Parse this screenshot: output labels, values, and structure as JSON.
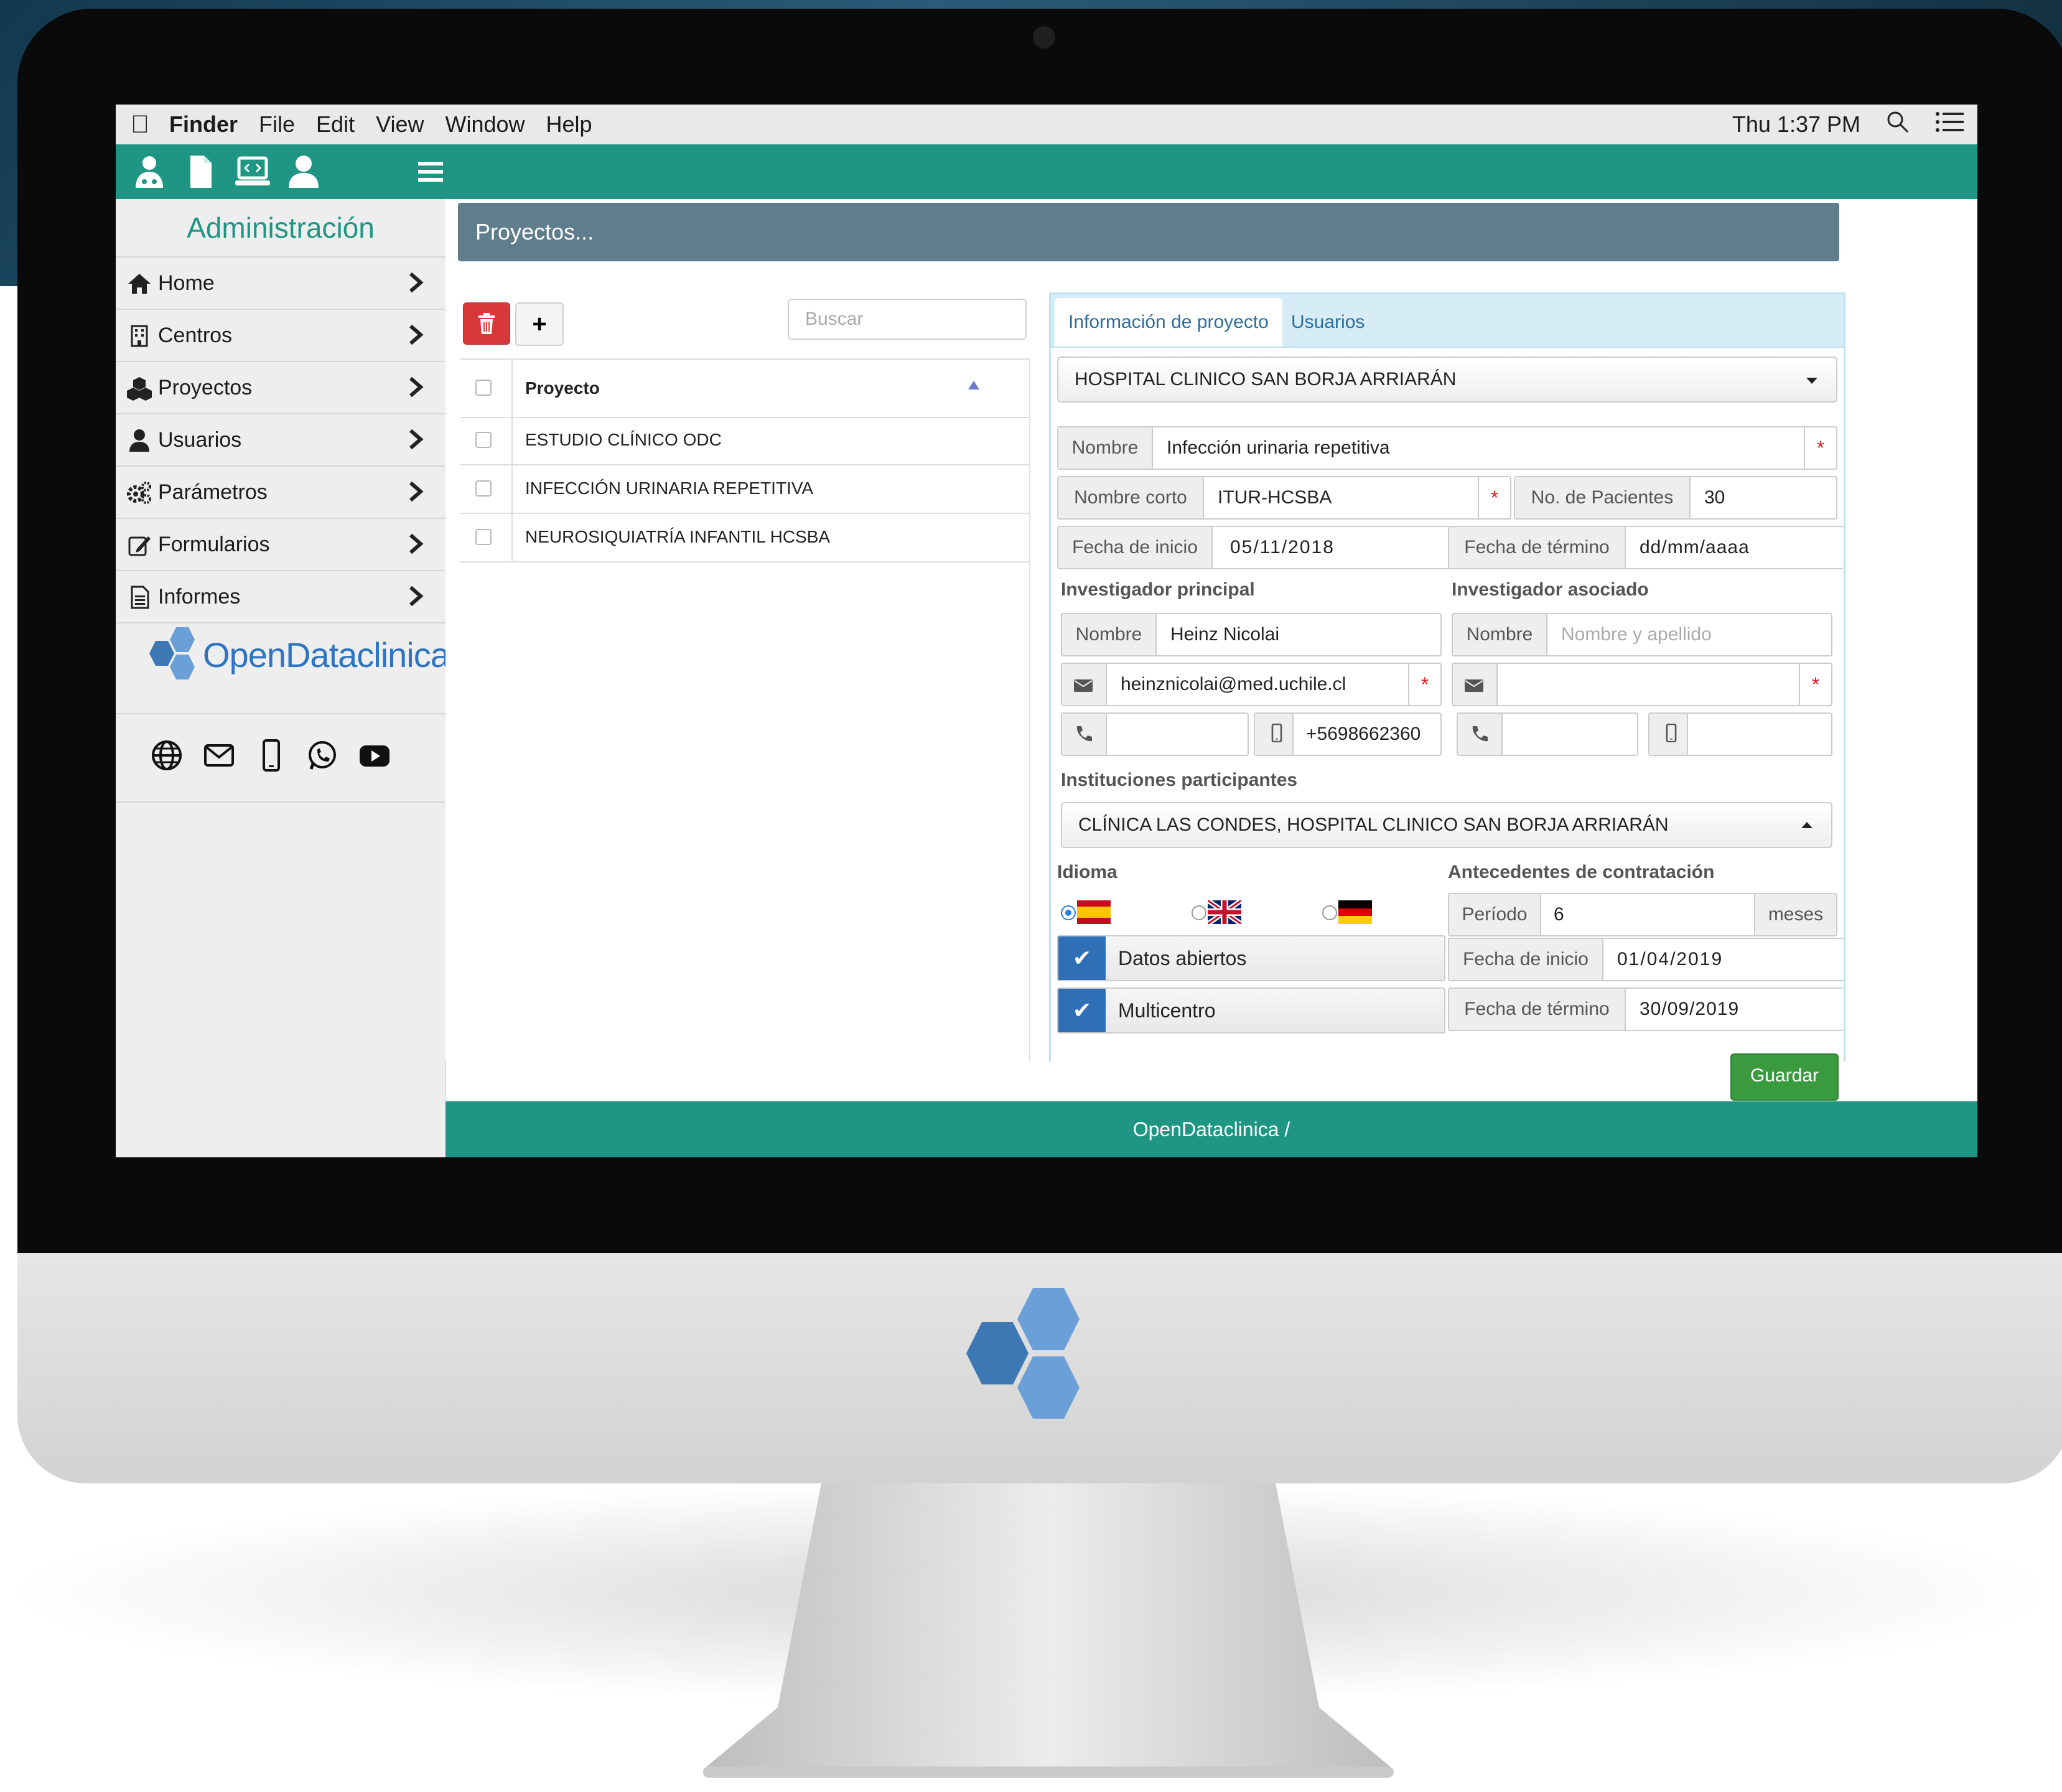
{
  "menubar": {
    "app": "Finder",
    "items": [
      "File",
      "Edit",
      "View",
      "Window",
      "Help"
    ],
    "clock": "Thu 1:37 PM"
  },
  "sidebar": {
    "title": "Administración",
    "items": [
      {
        "label": "Home",
        "icon": "home-icon"
      },
      {
        "label": "Centros",
        "icon": "building-icon"
      },
      {
        "label": "Proyectos",
        "icon": "cubes-icon"
      },
      {
        "label": "Usuarios",
        "icon": "user-icon"
      },
      {
        "label": "Parámetros",
        "icon": "cogs-icon"
      },
      {
        "label": "Formularios",
        "icon": "edit-icon"
      },
      {
        "label": "Informes",
        "icon": "file-icon"
      }
    ],
    "logo_text": "OpenDataclinica",
    "social": [
      "globe-icon",
      "mail-icon",
      "mobile-icon",
      "whatsapp-icon",
      "youtube-icon"
    ]
  },
  "page": {
    "header": "Proyectos...",
    "search_placeholder": "Buscar",
    "list_header": "Proyecto",
    "projects": [
      "ESTUDIO CLÍNICO ODC",
      "INFECCIÓN URINARIA REPETITIVA",
      "NEUROSIQUIATRÍA INFANTIL HCSBA"
    ]
  },
  "form": {
    "tabs": [
      "Información de proyecto",
      "Usuarios"
    ],
    "center": "HOSPITAL CLINICO SAN BORJA ARRIARÁN",
    "nombre_label": "Nombre",
    "nombre_value": "Infección urinaria repetitiva",
    "nombre_corto_label": "Nombre corto",
    "nombre_corto_value": "ITUR-HCSBA",
    "pacientes_label": "No. de Pacientes",
    "pacientes_value": "30",
    "fecha_inicio_label": "Fecha de inicio",
    "fecha_inicio_value": "05/11/2018",
    "fecha_termino_label": "Fecha de término",
    "fecha_termino_placeholder": "dd/mm/aaaa",
    "required_mark": "*",
    "inv_principal": {
      "heading": "Investigador principal",
      "nombre_label": "Nombre",
      "nombre_value": "Heinz Nicolai",
      "email": "heinznicolai@med.uchile.cl",
      "phone": "",
      "mobile": "+5698662360"
    },
    "inv_asociado": {
      "heading": "Investigador asociado",
      "nombre_label": "Nombre",
      "nombre_placeholder": "Nombre y apellido",
      "email": "",
      "phone": "",
      "mobile": ""
    },
    "instituciones_label": "Instituciones participantes",
    "instituciones_value": "CLÍNICA LAS CONDES, HOSPITAL CLINICO SAN BORJA ARRIARÁN",
    "idioma_label": "Idioma",
    "idioma_selected": "es",
    "contratacion_label": "Antecedentes de contratación",
    "periodo_label": "Período",
    "periodo_value": "6",
    "periodo_unit": "meses",
    "contrato_inicio_label": "Fecha de inicio",
    "contrato_inicio_value": "01/04/2019",
    "contrato_termino_label": "Fecha de término",
    "contrato_termino_value": "30/09/2019",
    "datos_abiertos": "Datos abiertos",
    "multicentro": "Multicentro",
    "save_label": "Guardar"
  },
  "footer": {
    "text": "OpenDataclinica /"
  },
  "colors": {
    "teal": "#1f9684",
    "header_gray": "#607d8b",
    "danger": "#d9383a",
    "success": "#3a9a3e",
    "check_blue": "#2f6fb6"
  }
}
